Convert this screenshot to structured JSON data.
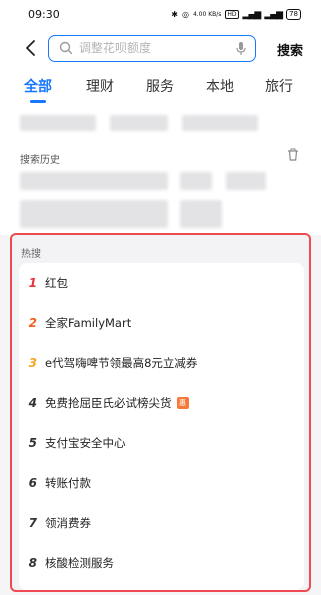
{
  "status_bar": {
    "time": "09:30",
    "network_speed": "4.00 KB/s",
    "battery": "78"
  },
  "header": {
    "search_placeholder": "调整花呗额度",
    "search_button": "搜索"
  },
  "tabs": [
    {
      "label": "全部",
      "active": true
    },
    {
      "label": "理财",
      "active": false
    },
    {
      "label": "服务",
      "active": false
    },
    {
      "label": "本地",
      "active": false
    },
    {
      "label": "旅行",
      "active": false
    }
  ],
  "history": {
    "title": "搜索历史"
  },
  "hot": {
    "title": "热搜",
    "badge_text": "惠",
    "items": [
      {
        "rank": "1",
        "label": "红包",
        "rank_color": "#e8323c"
      },
      {
        "rank": "2",
        "label": "全家FamilyMart",
        "rank_color": "#f2601e"
      },
      {
        "rank": "3",
        "label": "e代驾嗨啤节领最高8元立减券",
        "rank_color": "#f5a524"
      },
      {
        "rank": "4",
        "label": "免费抢屈臣氏必试榜尖货",
        "rank_color": "#333333"
      },
      {
        "rank": "5",
        "label": "支付宝安全中心",
        "rank_color": "#333333"
      },
      {
        "rank": "6",
        "label": "转账付款",
        "rank_color": "#333333"
      },
      {
        "rank": "7",
        "label": "领消费券",
        "rank_color": "#333333"
      },
      {
        "rank": "8",
        "label": "核酸检测服务",
        "rank_color": "#333333"
      }
    ]
  },
  "colors": {
    "accent": "#1677ff",
    "highlight_border": "#ef4a52"
  }
}
